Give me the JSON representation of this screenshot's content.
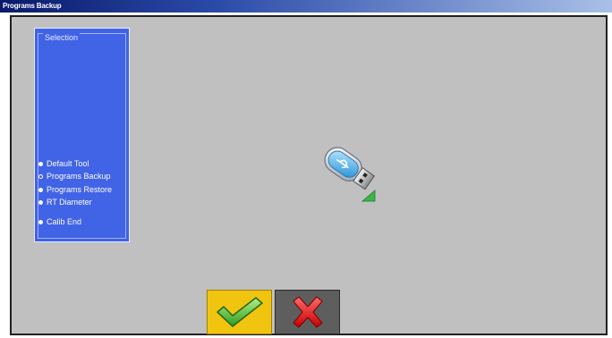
{
  "window": {
    "title": "Programs Backup"
  },
  "selection": {
    "title": "Selection",
    "options": [
      {
        "label": "Default Tool",
        "selected": false
      },
      {
        "label": "Programs Backup",
        "selected": true
      },
      {
        "label": "Programs Restore",
        "selected": false
      },
      {
        "label": "RT Diameter",
        "selected": false
      },
      {
        "label": "Calib End",
        "selected": false
      }
    ]
  },
  "icons": {
    "usb": "usb-drive-icon",
    "confirm": "checkmark-icon",
    "cancel": "cross-icon"
  },
  "colors": {
    "panel": "#4163e6",
    "background": "#c0c0c0",
    "confirm_button": "#f1c40f",
    "cancel_button": "#5e5e5e"
  }
}
